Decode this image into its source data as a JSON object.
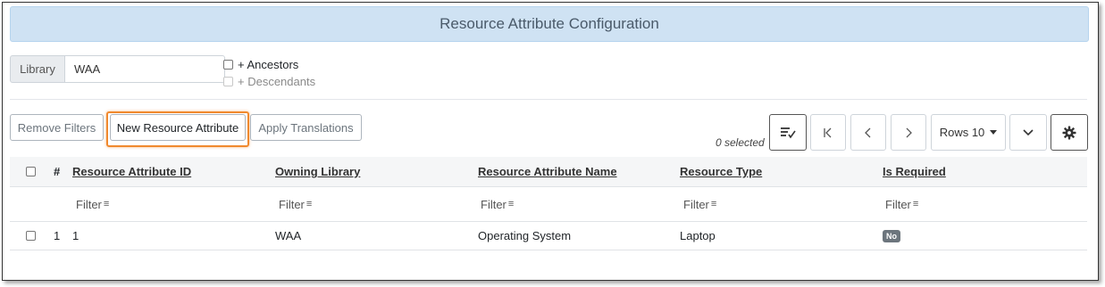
{
  "page": {
    "title": "Resource Attribute Configuration"
  },
  "library": {
    "label": "Library",
    "value": "WAA"
  },
  "options": {
    "ancestors": "+ Ancestors",
    "descendants": "+ Descendants"
  },
  "toolbar": {
    "remove_filters": "Remove Filters",
    "new_resource_attribute": "New Resource Attribute",
    "apply_translations": "Apply Translations",
    "selected": "0 selected",
    "rows": "Rows 10"
  },
  "table": {
    "index_header": "#",
    "columns": [
      "Resource Attribute ID",
      "Owning Library",
      "Resource Attribute Name",
      "Resource Type",
      "Is Required"
    ],
    "filter_label": "Filter",
    "rows": [
      {
        "index": "1",
        "id": "1",
        "owning_library": "WAA",
        "name": "Operating System",
        "resource_type": "Laptop",
        "is_required": "No"
      }
    ]
  },
  "icons": [
    "sort-check-icon",
    "first-page-icon",
    "prev-page-icon",
    "next-page-icon",
    "chevron-down-icon",
    "gear-icon",
    "filter-icon"
  ]
}
